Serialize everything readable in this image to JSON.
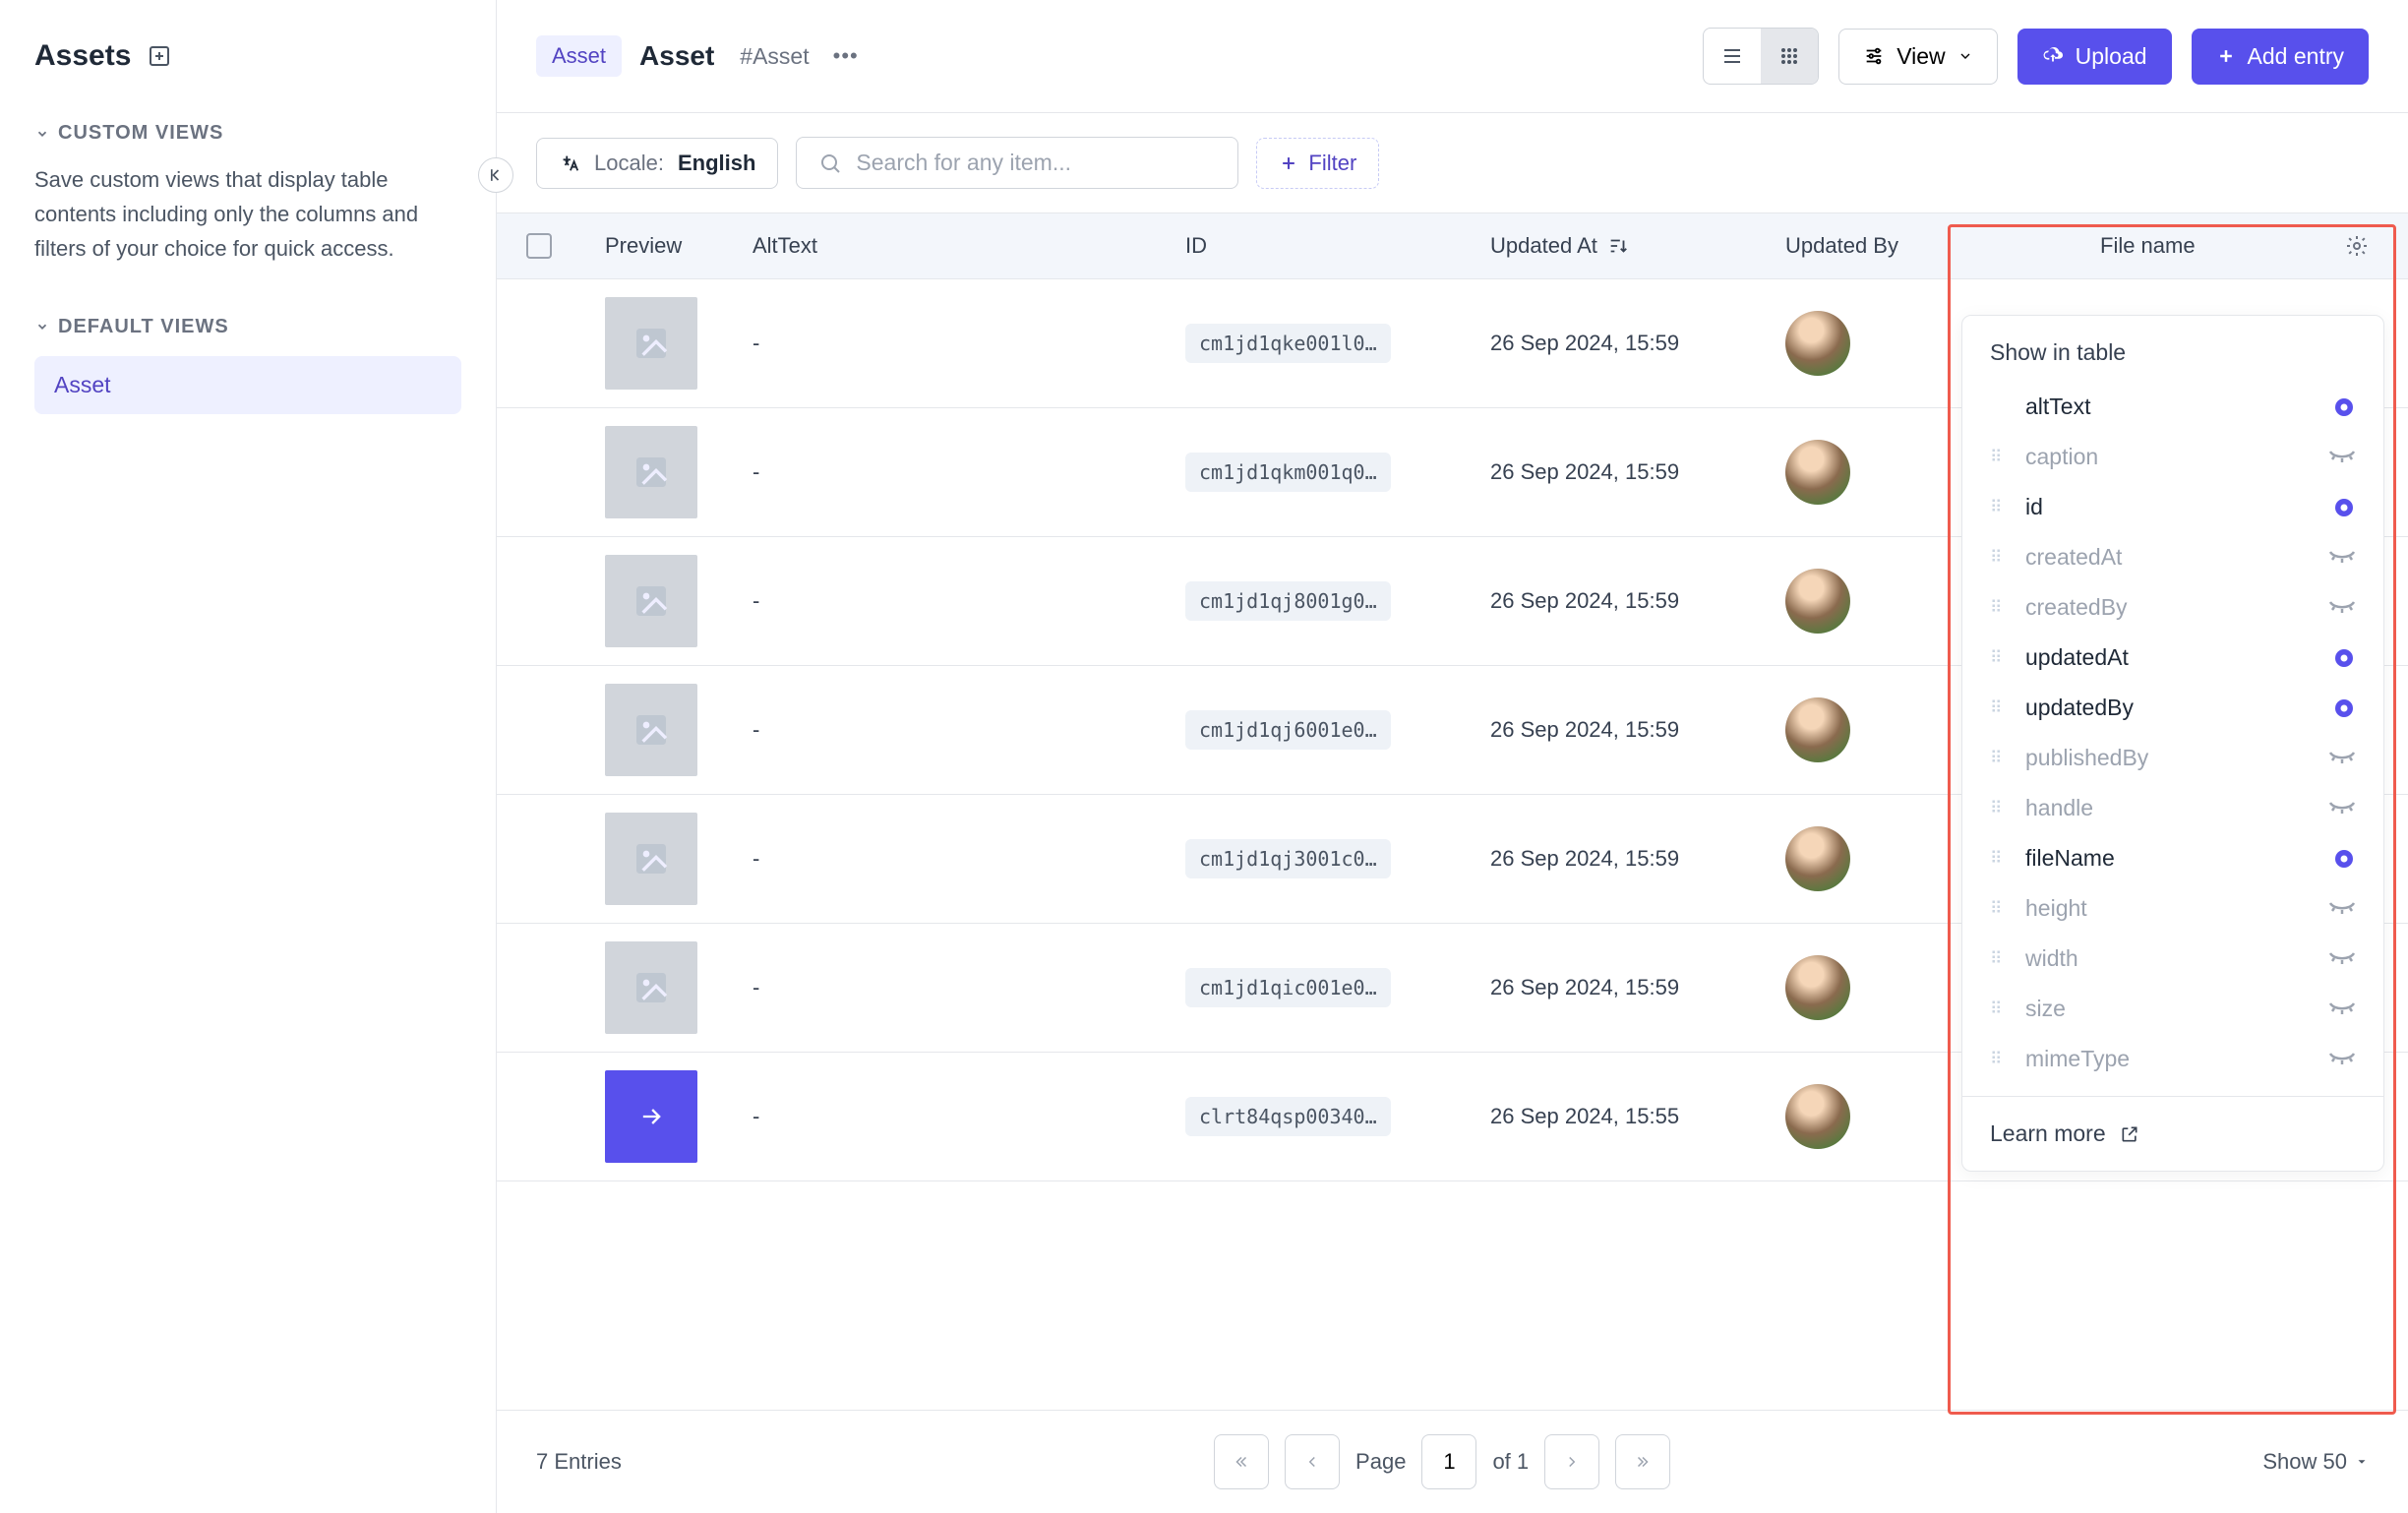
{
  "sidebar": {
    "title": "Assets",
    "custom_views_heading": "CUSTOM VIEWS",
    "custom_views_desc": "Save custom views that display table contents including only the columns and filters of your choice for quick access.",
    "default_views_heading": "DEFAULT VIEWS",
    "views": [
      {
        "label": "Asset"
      }
    ]
  },
  "header": {
    "chip": "Asset",
    "model_name": "Asset",
    "model_tag": "#Asset",
    "view_btn": "View",
    "upload_btn": "Upload",
    "add_btn": "Add entry"
  },
  "controls": {
    "locale_label": "Locale:",
    "locale_value": "English",
    "search_placeholder": "Search for any item...",
    "filter_btn": "Filter"
  },
  "table": {
    "columns": {
      "preview": "Preview",
      "alt": "AltText",
      "id": "ID",
      "updated_at": "Updated At",
      "updated_by": "Updated By",
      "file_name": "File name"
    },
    "rows": [
      {
        "alt": "-",
        "id": "cm1jd1qke001l0…",
        "updated": "26 Sep 2024, 15:59",
        "thumb": "img"
      },
      {
        "alt": "-",
        "id": "cm1jd1qkm001q0…",
        "updated": "26 Sep 2024, 15:59",
        "thumb": "img"
      },
      {
        "alt": "-",
        "id": "cm1jd1qj8001g0…",
        "updated": "26 Sep 2024, 15:59",
        "thumb": "img"
      },
      {
        "alt": "-",
        "id": "cm1jd1qj6001e0…",
        "updated": "26 Sep 2024, 15:59",
        "thumb": "img"
      },
      {
        "alt": "-",
        "id": "cm1jd1qj3001c0…",
        "updated": "26 Sep 2024, 15:59",
        "thumb": "img"
      },
      {
        "alt": "-",
        "id": "cm1jd1qic001e0…",
        "updated": "26 Sep 2024, 15:59",
        "thumb": "img"
      },
      {
        "alt": "-",
        "id": "clrt84qsp00340…",
        "updated": "26 Sep 2024, 15:55",
        "thumb": "purple"
      }
    ]
  },
  "popover": {
    "title": "Show in table",
    "fields": [
      {
        "name": "altText",
        "visible": true,
        "muted": false,
        "dragVisible": false
      },
      {
        "name": "caption",
        "visible": false,
        "muted": true,
        "dragVisible": true
      },
      {
        "name": "id",
        "visible": true,
        "muted": false,
        "dragVisible": true
      },
      {
        "name": "createdAt",
        "visible": false,
        "muted": true,
        "dragVisible": true
      },
      {
        "name": "createdBy",
        "visible": false,
        "muted": true,
        "dragVisible": true
      },
      {
        "name": "updatedAt",
        "visible": true,
        "muted": false,
        "dragVisible": true
      },
      {
        "name": "updatedBy",
        "visible": true,
        "muted": false,
        "dragVisible": true
      },
      {
        "name": "publishedBy",
        "visible": false,
        "muted": true,
        "dragVisible": true
      },
      {
        "name": "handle",
        "visible": false,
        "muted": true,
        "dragVisible": true
      },
      {
        "name": "fileName",
        "visible": true,
        "muted": false,
        "dragVisible": true
      },
      {
        "name": "height",
        "visible": false,
        "muted": true,
        "dragVisible": true
      },
      {
        "name": "width",
        "visible": false,
        "muted": true,
        "dragVisible": true
      },
      {
        "name": "size",
        "visible": false,
        "muted": true,
        "dragVisible": true
      },
      {
        "name": "mimeType",
        "visible": false,
        "muted": true,
        "dragVisible": true
      }
    ],
    "learn_more": "Learn more"
  },
  "footer": {
    "entries": "7 Entries",
    "page_label": "Page",
    "page_value": "1",
    "of_label": "of 1",
    "show_label": "Show 50"
  }
}
